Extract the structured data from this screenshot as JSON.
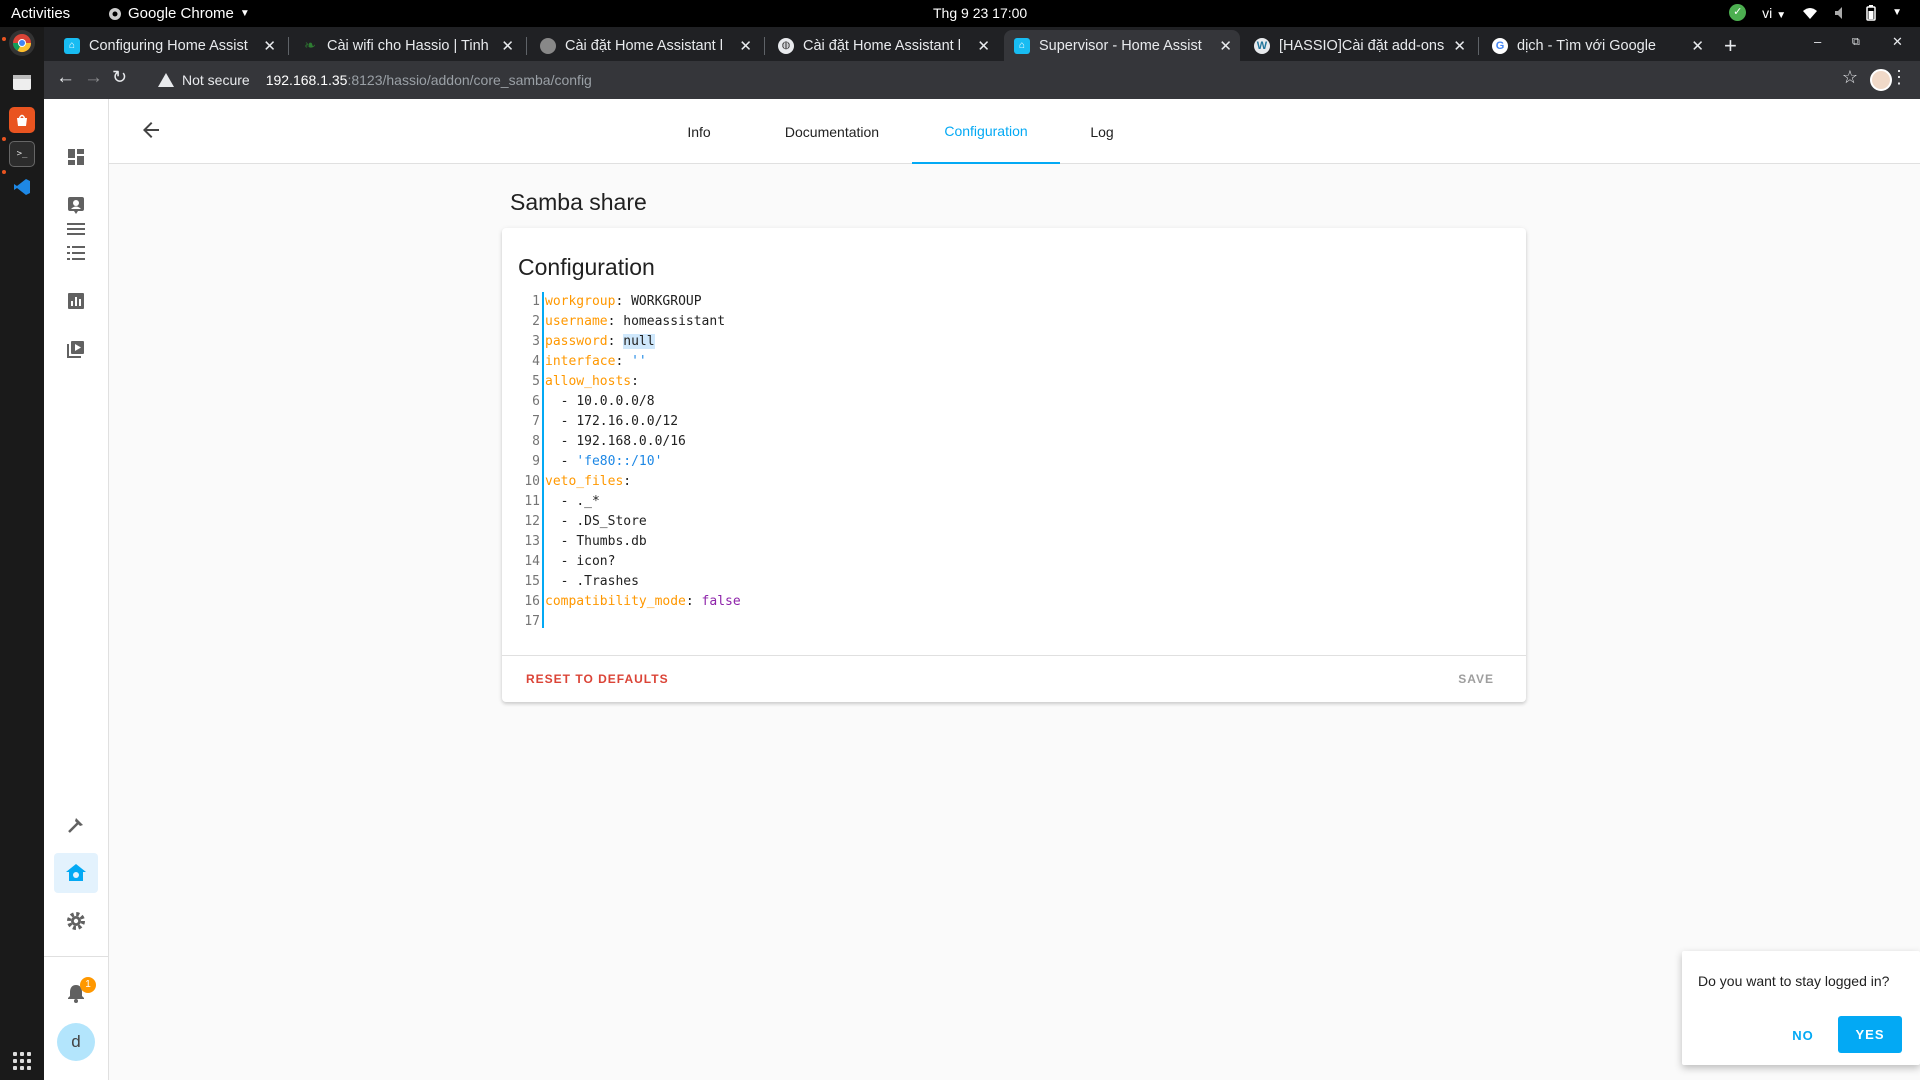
{
  "system": {
    "activities": "Activities",
    "app_name": "Google Chrome",
    "clock": "Thg 9 23  17:00",
    "lang": "vi"
  },
  "browser": {
    "tabs": [
      {
        "title": "Configuring Home Assist",
        "favicon": "home-assistant-icon",
        "active": false
      },
      {
        "title": "Cài wifi cho Hassio | Tinh",
        "favicon": "leaf-icon",
        "active": false
      },
      {
        "title": "Cài đặt Home Assistant l",
        "favicon": "blog-icon",
        "active": false
      },
      {
        "title": "Cài đặt Home Assistant l",
        "favicon": "globe-icon",
        "active": false
      },
      {
        "title": "Supervisor - Home Assist",
        "favicon": "home-assistant-icon",
        "active": true
      },
      {
        "title": "[HASSIO]Cài đặt add-ons",
        "favicon": "wordpress-icon",
        "active": false
      },
      {
        "title": "dịch - Tìm với Google",
        "favicon": "google-icon",
        "active": false
      }
    ],
    "security_label": "Not secure",
    "url_host": "192.168.1.35",
    "url_path": ":8123/hassio/addon/core_samba/config"
  },
  "ha": {
    "tabs": [
      "Info",
      "Documentation",
      "Configuration",
      "Log"
    ],
    "active_tab": "Configuration",
    "page_title": "Samba share",
    "card_title": "Configuration",
    "reset_label": "RESET TO DEFAULTS",
    "save_label": "SAVE",
    "notification_count": "1",
    "user_initial": "d"
  },
  "yaml": [
    "workgroup: WORKGROUP",
    "username: homeassistant",
    "password: null",
    "interface: ''",
    "allow_hosts:",
    "  - 10.0.0.0/8",
    "  - 172.16.0.0/12",
    "  - 192.168.0.0/16",
    "  - 'fe80::/10'",
    "veto_files:",
    "  - ._*",
    "  - .DS_Store",
    "  - Thumbs.db",
    "  - icon?",
    "  - .Trashes",
    "compatibility_mode: false",
    ""
  ],
  "dialog": {
    "message": "Do you want to stay logged in?",
    "no_label": "NO",
    "yes_label": "YES"
  },
  "colors": {
    "accent": "#03a9f4",
    "key": "#ff9800",
    "danger": "#db4437"
  }
}
